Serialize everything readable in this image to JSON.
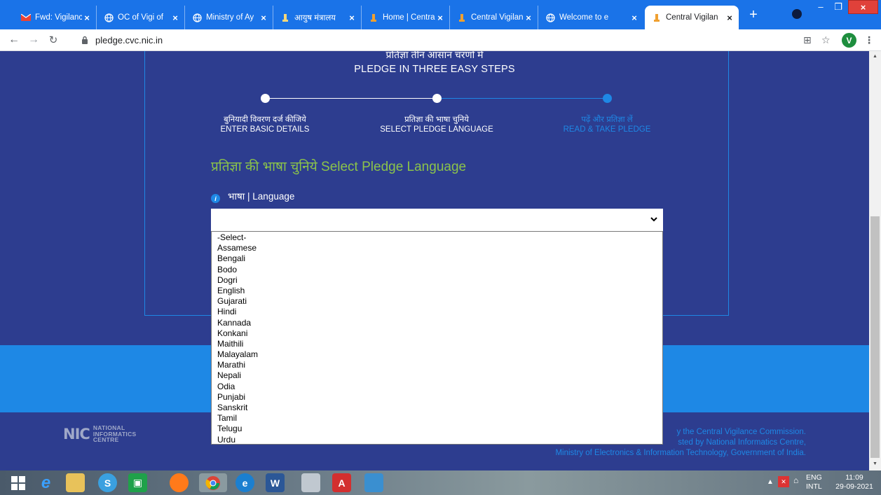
{
  "browser": {
    "tabs": [
      {
        "title": "Fwd: Vigilance",
        "active": false
      },
      {
        "title": "OC of Vigi of",
        "active": false
      },
      {
        "title": "Ministry of Ay",
        "active": false
      },
      {
        "title": "आयुष मंत्रालय",
        "active": false
      },
      {
        "title": "Home | Centra",
        "active": false
      },
      {
        "title": "Central Vigilan",
        "active": false
      },
      {
        "title": "Welcome to e",
        "active": false
      },
      {
        "title": "Central Vigilan",
        "active": true
      }
    ],
    "new_tab": "+",
    "url": "pledge.cvc.nic.in",
    "profile_initial": "V"
  },
  "page": {
    "heading_hindi": "प्रतिज्ञा तीन आसान चरणों में",
    "heading_english": "PLEDGE IN THREE EASY STEPS",
    "steps": [
      {
        "hindi": "बुनियादी विवरण दर्ज कीजिये",
        "english": "ENTER BASIC DETAILS",
        "active": false
      },
      {
        "hindi": "प्रतिज्ञा की भाषा चुनिये",
        "english": "SELECT PLEDGE LANGUAGE",
        "active": false
      },
      {
        "hindi": "पढ़ें और प्रतिज्ञा लें",
        "english": "READ & TAKE PLEDGE",
        "active": true
      }
    ],
    "section_title": "प्रतिज्ञा की भाषा चुनिये Select Pledge Language",
    "language_label": "भाषा | Language",
    "language_select": {
      "value": "",
      "options": [
        "-Select-",
        "Assamese",
        "Bengali",
        "Bodo",
        "Dogri",
        "English",
        "Gujarati",
        "Hindi",
        "Kannada",
        "Konkani",
        "Maithili",
        "Malayalam",
        "Marathi",
        "Nepali",
        "Odia",
        "Punjabi",
        "Sanskrit",
        "Tamil",
        "Telugu",
        "Urdu"
      ]
    }
  },
  "footer": {
    "logo_mark": "NIC",
    "logo_text": [
      "NATIONAL",
      "INFORMATICS",
      "CENTRE"
    ],
    "line1": "y the Central Vigilance Commission.",
    "line2": "sted by National Informatics Centre,",
    "line3": "Ministry of Electronics & Information Technology, Government of India."
  },
  "taskbar": {
    "lang_top": "ENG",
    "lang_bottom": "INTL",
    "time": "11:09",
    "date": "29-09-2021"
  },
  "colors": {
    "page_bg": "#2d3d8f",
    "accent_blue": "#1e88e5",
    "title_green": "#8bc34a",
    "chrome_blue": "#1a73e8"
  }
}
